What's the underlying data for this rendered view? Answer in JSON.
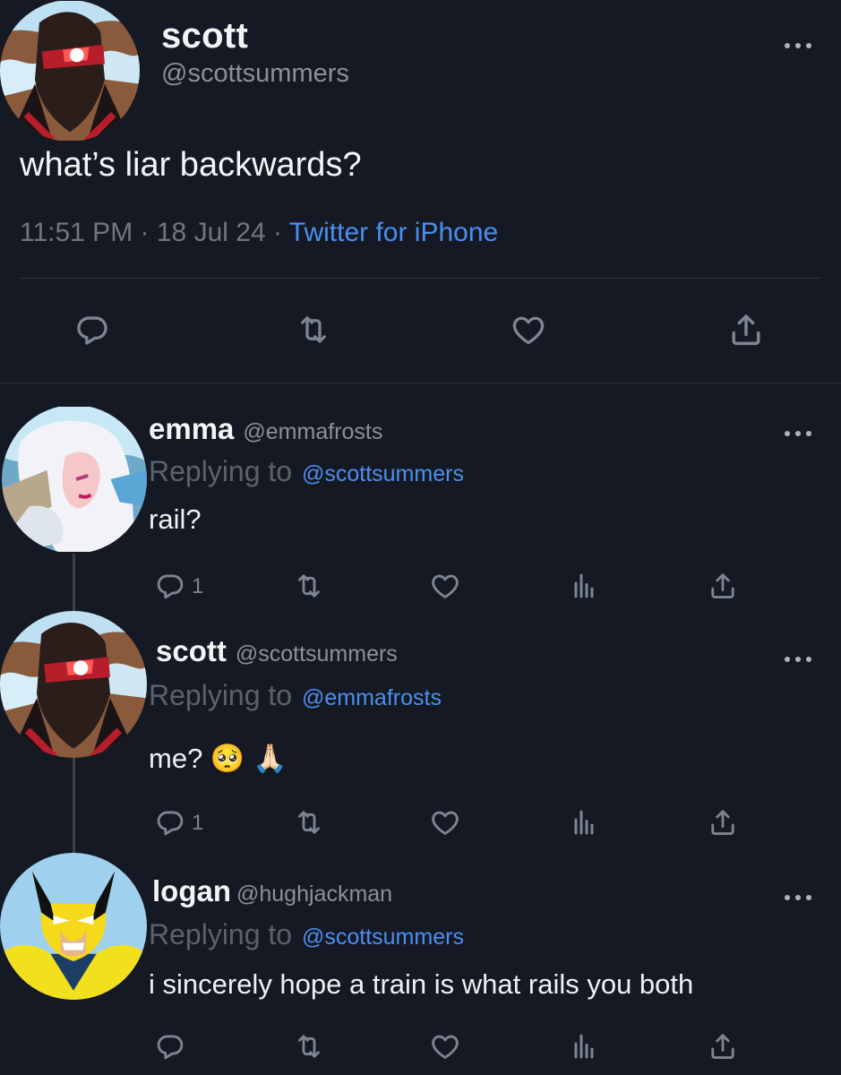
{
  "main": {
    "name": "scott",
    "handle": "@scottsummers",
    "text": "what’s liar backwards?",
    "time": "11:51 PM",
    "date": "18 Jul 24",
    "sep": "·",
    "source": "Twitter for iPhone",
    "actions": [
      "reply-icon",
      "retweet-icon",
      "like-icon",
      "share-icon"
    ]
  },
  "replies": [
    {
      "name": "emma",
      "handle": "@emmafrosts",
      "replying_prefix": "Replying to",
      "replying_to": "@scottsummers",
      "text": "rail?",
      "reply_count": "1",
      "icons": [
        "reply-icon",
        "retweet-icon",
        "like-icon",
        "analytics-icon",
        "share-icon"
      ]
    },
    {
      "name": "scott",
      "handle": "@scottsummers",
      "replying_prefix": "Replying to",
      "replying_to": "@emmafrosts",
      "text": "me? 🥺 🙏🏻",
      "reply_count": "1",
      "icons": [
        "reply-icon",
        "retweet-icon",
        "like-icon",
        "analytics-icon",
        "share-icon"
      ]
    },
    {
      "name": "logan",
      "handle": "@hughjackman",
      "replying_prefix": "Replying to",
      "replying_to": "@scottsummers",
      "text": "i sincerely hope a train is what rails you both",
      "icons": [
        "reply-icon",
        "retweet-icon",
        "like-icon",
        "analytics-icon",
        "share-icon"
      ]
    }
  ],
  "colors": {
    "background": "#151923",
    "accent": "#4b8ff0",
    "muted": "#7c8590"
  }
}
